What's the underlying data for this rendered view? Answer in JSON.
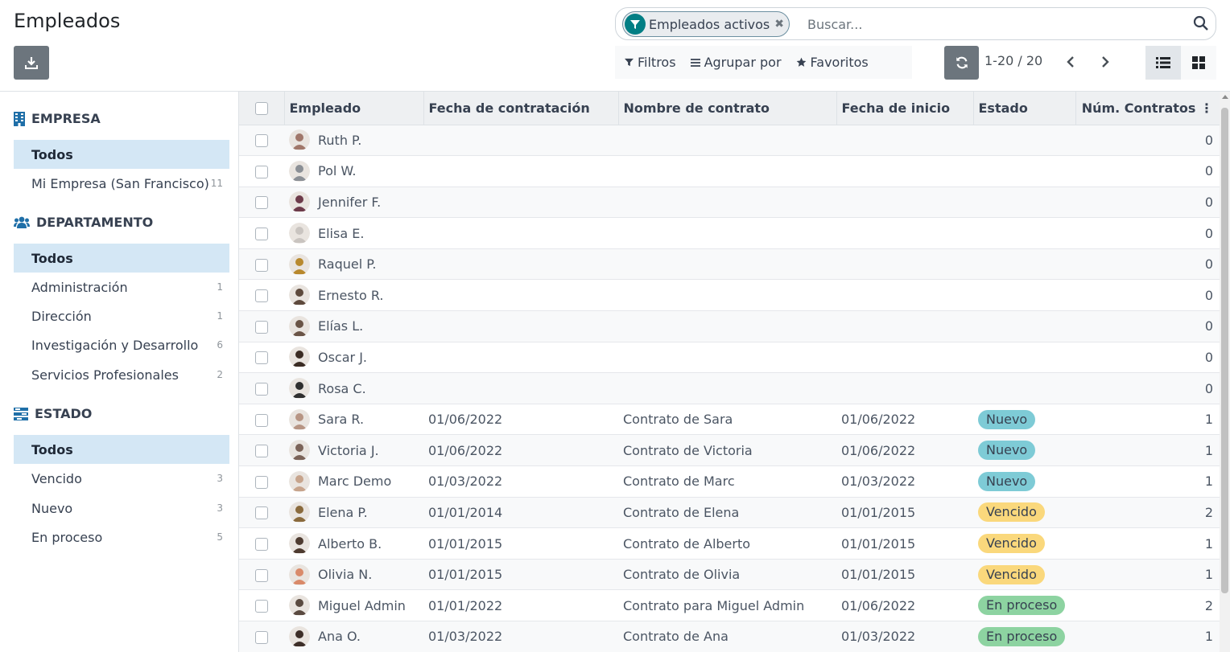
{
  "page": {
    "title": "Empleados"
  },
  "search": {
    "facet_label": "Empleados activos",
    "placeholder": "Buscar..."
  },
  "toolbar": {
    "filters_label": "Filtros",
    "group_label": "Agrupar por",
    "favorites_label": "Favoritos",
    "pager": "1-20 / 20"
  },
  "sidebar": {
    "sections": [
      {
        "title": "EMPRESA",
        "icon": "building-icon",
        "items": [
          {
            "label": "Todos",
            "count": "",
            "active": true
          },
          {
            "label": "Mi Empresa (San Francisco)",
            "count": "11",
            "active": false
          }
        ]
      },
      {
        "title": "DEPARTAMENTO",
        "icon": "users-icon",
        "items": [
          {
            "label": "Todos",
            "count": "",
            "active": true
          },
          {
            "label": "Administración",
            "count": "1",
            "active": false
          },
          {
            "label": "Dirección",
            "count": "1",
            "active": false
          },
          {
            "label": "Investigación y Desarrollo",
            "count": "6",
            "active": false
          },
          {
            "label": "Servicios Profesionales",
            "count": "2",
            "active": false
          }
        ]
      },
      {
        "title": "ESTADO",
        "icon": "tasks-icon",
        "items": [
          {
            "label": "Todos",
            "count": "",
            "active": true
          },
          {
            "label": "Vencido",
            "count": "3",
            "active": false
          },
          {
            "label": "Nuevo",
            "count": "3",
            "active": false
          },
          {
            "label": "En proceso",
            "count": "5",
            "active": false
          }
        ]
      }
    ]
  },
  "table": {
    "columns": [
      "Empleado",
      "Fecha de contratación",
      "Nombre de contrato",
      "Fecha de inicio",
      "Estado",
      "Núm. Contratos"
    ],
    "rows": [
      {
        "employee": "Ruth P.",
        "hire": "",
        "contract": "",
        "start": "",
        "state": "",
        "count": "0",
        "avatar": "#a0776a"
      },
      {
        "employee": "Pol W.",
        "hire": "",
        "contract": "",
        "start": "",
        "state": "",
        "count": "0",
        "avatar": "#8b8f95"
      },
      {
        "employee": "Jennifer F.",
        "hire": "",
        "contract": "",
        "start": "",
        "state": "",
        "count": "0",
        "avatar": "#6d3b4a"
      },
      {
        "employee": "Elisa E.",
        "hire": "",
        "contract": "",
        "start": "",
        "state": "",
        "count": "0",
        "avatar": "#c9c4c0"
      },
      {
        "employee": "Raquel P.",
        "hire": "",
        "contract": "",
        "start": "",
        "state": "",
        "count": "0",
        "avatar": "#b8892e"
      },
      {
        "employee": "Ernesto R.",
        "hire": "",
        "contract": "",
        "start": "",
        "state": "",
        "count": "0",
        "avatar": "#5e4a3d"
      },
      {
        "employee": "Elías L.",
        "hire": "",
        "contract": "",
        "start": "",
        "state": "",
        "count": "0",
        "avatar": "#6a5446"
      },
      {
        "employee": "Oscar J.",
        "hire": "",
        "contract": "",
        "start": "",
        "state": "",
        "count": "0",
        "avatar": "#3b2c24"
      },
      {
        "employee": "Rosa C.",
        "hire": "",
        "contract": "",
        "start": "",
        "state": "",
        "count": "0",
        "avatar": "#2f2f2f"
      },
      {
        "employee": "Sara R.",
        "hire": "01/06/2022",
        "contract": "Contrato de Sara",
        "start": "01/06/2022",
        "state": "Nuevo",
        "count": "1",
        "avatar": "#b79584"
      },
      {
        "employee": "Victoria J.",
        "hire": "01/06/2022",
        "contract": "Contrato de Victoria",
        "start": "01/06/2022",
        "state": "Nuevo",
        "count": "1",
        "avatar": "#7b6358"
      },
      {
        "employee": "Marc Demo",
        "hire": "01/03/2022",
        "contract": "Contrato de Marc",
        "start": "01/03/2022",
        "state": "Nuevo",
        "count": "1",
        "avatar": "#c7a48c"
      },
      {
        "employee": "Elena P.",
        "hire": "01/01/2014",
        "contract": "Contrato de Elena",
        "start": "01/01/2015",
        "state": "Vencido",
        "count": "2",
        "avatar": "#8a6a3c"
      },
      {
        "employee": "Alberto B.",
        "hire": "01/01/2015",
        "contract": "Contrato de Alberto",
        "start": "01/01/2015",
        "state": "Vencido",
        "count": "1",
        "avatar": "#4e3b30"
      },
      {
        "employee": "Olivia N.",
        "hire": "01/01/2015",
        "contract": "Contrato de Olivia",
        "start": "01/01/2015",
        "state": "Vencido",
        "count": "1",
        "avatar": "#d98a6a"
      },
      {
        "employee": "Miguel Admin",
        "hire": "01/01/2022",
        "contract": "Contrato para Miguel Admin",
        "start": "01/06/2022",
        "state": "En proceso",
        "count": "2",
        "avatar": "#5a4a40"
      },
      {
        "employee": "Ana O.",
        "hire": "01/03/2022",
        "contract": "Contrato de Ana",
        "start": "01/03/2022",
        "state": "En proceso",
        "count": "1",
        "avatar": "#3d2e28"
      }
    ]
  },
  "colors": {
    "accent": "#017e84",
    "active_filter_bg": "#d4e7f5",
    "badge_nuevo": "#7ecbd6",
    "badge_vencido": "#fad87c",
    "badge_en_proceso": "#8dd3a1"
  }
}
